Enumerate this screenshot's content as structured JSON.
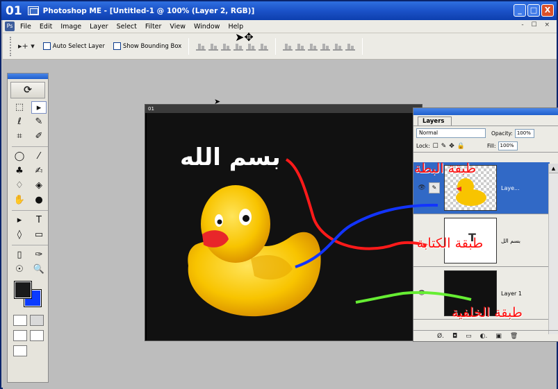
{
  "window": {
    "tab_number": "01",
    "title": "Photoshop ME - [Untitled-1 @ 100% (Layer 2, RGB)]",
    "minimize_label": "_",
    "maximize_label": "□",
    "close_label": "X"
  },
  "menu": {
    "items": [
      "File",
      "Edit",
      "Image",
      "Layer",
      "Select",
      "Filter",
      "View",
      "Window",
      "Help"
    ],
    "mdi_controls": "- ☐ ×"
  },
  "options": {
    "auto_select": "Auto Select Layer",
    "bounding_box": "Show Bounding Box"
  },
  "tools": {
    "items": [
      "⬚",
      "▸",
      "ℓ",
      "✎",
      "⌗",
      "✐",
      "◯",
      "⁄",
      "♣",
      "✍",
      "♢",
      "◈",
      "✋",
      "●",
      "▸",
      "T",
      "◊",
      "▭",
      "▯",
      "✑",
      "☉",
      "🔍"
    ]
  },
  "document": {
    "title": "01",
    "canvas_text": "بسم الله"
  },
  "layers_panel": {
    "tab_label": "Layers",
    "blend_mode": "Normal",
    "opacity_label": "Opacity:",
    "opacity_value": "100%",
    "lock_label": "Lock:",
    "fill_label": "Fill:",
    "fill_value": "100%",
    "layers": [
      {
        "name": "Laye...",
        "thumb": "duck",
        "selected": true
      },
      {
        "name": "بسم الل",
        "thumb": "text",
        "selected": false
      },
      {
        "name": "Layer 1",
        "thumb": "black",
        "selected": false
      }
    ],
    "thumb_text": "T"
  },
  "annotations": {
    "duck_layer": "طبقة البطة",
    "text_layer": "طبقة الكتابة",
    "background_layer": "طبقة الخلفية"
  },
  "colors": {
    "foreground": "#1a1a1a",
    "background": "#0b3bff",
    "annotation": "#ff1010",
    "selection": "#3169c6"
  }
}
